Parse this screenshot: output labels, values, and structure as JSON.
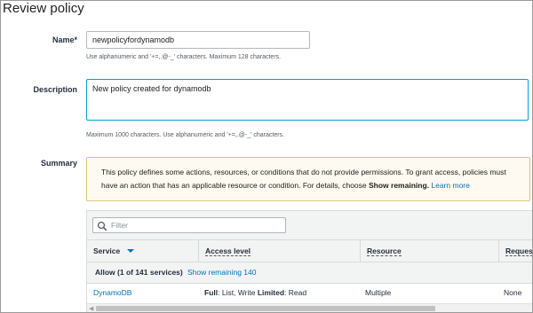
{
  "page": {
    "title": "Review policy"
  },
  "name_field": {
    "label": "Name*",
    "value": "newpolicyfordynamodb",
    "hint": "Use alphanumeric and '+=,.@-_' characters. Maximum 128 characters."
  },
  "description_field": {
    "label": "Description",
    "value": "New policy created for dynamodb",
    "hint": "Maximum 1000 characters. Use alphanumeric and '+=,.@-_' characters."
  },
  "summary": {
    "label": "Summary",
    "notice_text": "This policy defines some actions, resources, or conditions that do not provide permissions. To grant access, policies must have an action that has an applicable resource or condition. For details, choose ",
    "notice_bold": "Show remaining.",
    "notice_link": "Learn more",
    "filter_placeholder": "Filter",
    "columns": [
      "Service",
      "Access level",
      "Resource",
      "Reques"
    ],
    "group_label": "Allow (1 of 141 services)",
    "group_link": "Show remaining 140",
    "row": {
      "service": "DynamoDB",
      "access_full": "Full",
      "access_full_rest": ": List, Write ",
      "access_limited": "Limited",
      "access_limited_rest": ": Read",
      "resource": "Multiple",
      "request": "None"
    }
  },
  "colors": {
    "link": "#0073bb",
    "focus_border": "#00a1c9",
    "notice_border": "#e0c47a",
    "notice_bg": "#fefaf1"
  }
}
